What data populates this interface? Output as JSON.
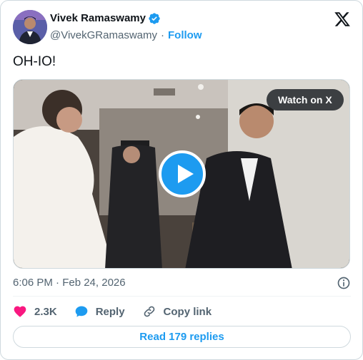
{
  "author": {
    "name": "Vivek Ramaswamy",
    "handle": "@VivekGRamaswamy",
    "separator": "·",
    "follow_label": "Follow",
    "verified_color": "#1d9bf0"
  },
  "tweet": {
    "text": "OH-IO!",
    "timestamp": "6:06 PM · Feb 24, 2026"
  },
  "media": {
    "watch_label": "Watch on X",
    "play_icon": "play-icon"
  },
  "actions": {
    "likes": "2.3K",
    "reply_label": "Reply",
    "copy_label": "Copy link"
  },
  "read_replies_label": "Read 179 replies",
  "colors": {
    "accent": "#1d9bf0",
    "like": "#f91880",
    "muted": "#536471"
  }
}
